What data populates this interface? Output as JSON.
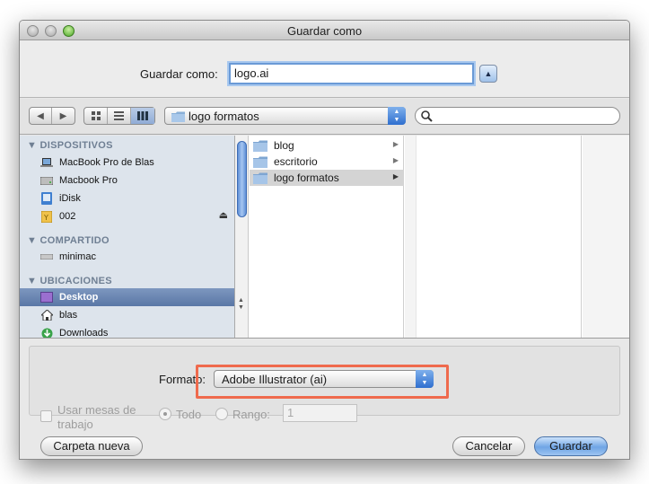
{
  "window": {
    "title": "Guardar como"
  },
  "save_as": {
    "label": "Guardar como:",
    "value": "logo.ai"
  },
  "toolbar": {
    "path_popup": "logo formatos",
    "search_placeholder": ""
  },
  "sidebar": {
    "sections": [
      {
        "title": "DISPOSITIVOS",
        "items": [
          {
            "label": "MacBook Pro de Blas",
            "icon": "laptop-icon"
          },
          {
            "label": "Macbook Pro",
            "icon": "hard-disk-icon"
          },
          {
            "label": "iDisk",
            "icon": "idisk-icon"
          },
          {
            "label": "002",
            "icon": "sd-card-icon",
            "ejectable": true
          }
        ]
      },
      {
        "title": "COMPARTIDO",
        "items": [
          {
            "label": "minimac",
            "icon": "network-computer-icon"
          }
        ]
      },
      {
        "title": "UBICACIONES",
        "items": [
          {
            "label": "Desktop",
            "icon": "desktop-icon",
            "selected": true
          },
          {
            "label": "blas",
            "icon": "home-icon"
          },
          {
            "label": "Downloads",
            "icon": "downloads-icon"
          }
        ]
      }
    ]
  },
  "browser": {
    "column1": [
      {
        "label": "blog",
        "icon": "folder-icon"
      },
      {
        "label": "escritorio",
        "icon": "folder-icon"
      },
      {
        "label": "logo formatos",
        "icon": "folder-icon",
        "selected": true
      }
    ]
  },
  "options": {
    "format_label": "Formato:",
    "format_value": "Adobe Illustrator (ai)",
    "artboards_label_line1": "Usar mesas de",
    "artboards_label_line2": "trabajo",
    "all_label": "Todo",
    "range_label": "Rango:",
    "range_value": "1"
  },
  "buttons": {
    "new_folder": "Carpeta nueva",
    "cancel": "Cancelar",
    "save": "Guardar"
  },
  "colors": {
    "highlight": "#ef6a4d",
    "accent": "#5a77a6"
  }
}
